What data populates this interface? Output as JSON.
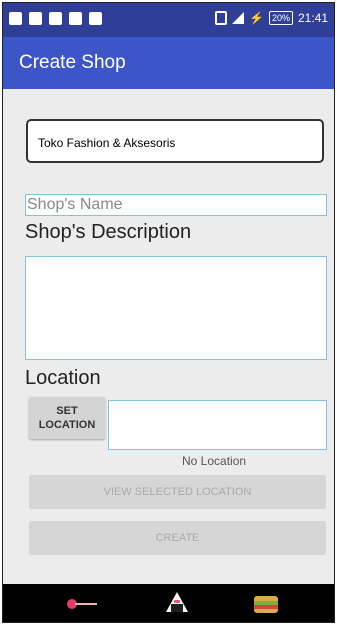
{
  "status_bar": {
    "battery": "20%",
    "time": "21:41"
  },
  "app_bar": {
    "title": "Create Shop"
  },
  "form": {
    "shop_name_value": "Toko Fashion & Aksesoris",
    "shop_name_hint": "Shop's Name",
    "description_label": "Shop's Description",
    "location_label": "Location",
    "set_location_line1": "SET",
    "set_location_line2": "LOCATION",
    "location_status": "No Location",
    "view_location_label": "VIEW SELECTED LOCATION",
    "create_label": "CREATE"
  },
  "bottom_nav": {
    "items": [
      "pin-icon",
      "onigiri-icon",
      "sandwich-icon"
    ]
  },
  "colors": {
    "status_bar": "#2f3e96",
    "app_bar": "#3d56c7",
    "accent_border": "#7fc6d8"
  }
}
